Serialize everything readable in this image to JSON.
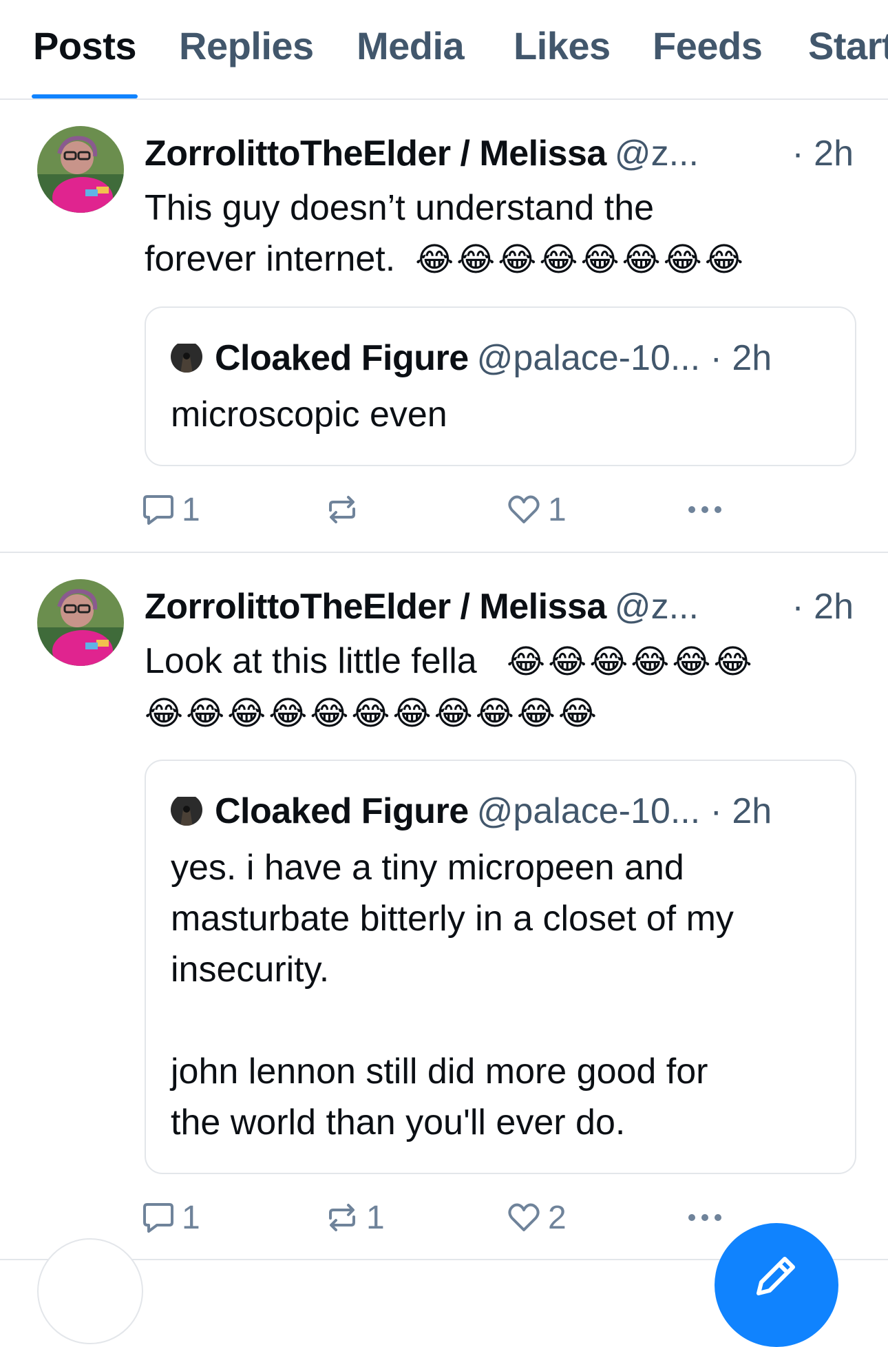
{
  "tabs": [
    {
      "label": "Posts",
      "active": true
    },
    {
      "label": "Replies",
      "active": false
    },
    {
      "label": "Media",
      "active": false
    },
    {
      "label": "Likes",
      "active": false
    },
    {
      "label": "Feeds",
      "active": false
    },
    {
      "label": "Starter Packs",
      "active": false
    }
  ],
  "colors": {
    "accent": "#1083fe",
    "text_primary": "#0b0f14",
    "text_secondary": "#42576c",
    "icon": "#6f839a",
    "divider": "#e3e6ea"
  },
  "posts": [
    {
      "author_name": "ZorrolittoTheElder / Melissa",
      "author_handle": "@z...",
      "time": "· 2h",
      "text": "This guy doesn’t understand the\nforever internet.",
      "emoji": "😂😂😂😂😂😂😂😂",
      "quote": {
        "author_name": "Cloaked Figure",
        "author_handle": "@palace-10...",
        "time": "· 2h",
        "text": "microscopic even"
      },
      "actions": {
        "reply_count": "1",
        "repost_count": "",
        "like_count": "1"
      }
    },
    {
      "author_name": "ZorrolittoTheElder / Melissa",
      "author_handle": "@z...",
      "time": "· 2h",
      "text": "Look at this little fella",
      "emoji_line1": "😂😂😂😂😂😂",
      "emoji_line2": "😂😂😂😂😂😂😂😂😂😂😂",
      "quote": {
        "author_name": "Cloaked Figure",
        "author_handle": "@palace-10...",
        "time": "· 2h",
        "text": "yes. i have a tiny micropeen and\nmasturbate bitterly in a closet of my\ninsecurity.\n\njohn lennon still did more good for\nthe world than you'll ever do."
      },
      "actions": {
        "reply_count": "1",
        "repost_count": "1",
        "like_count": "2"
      }
    }
  ],
  "icons": {
    "reply": "speech-bubble-icon",
    "repost": "repost-arrows-icon",
    "like": "heart-icon",
    "more": "ellipsis-icon",
    "compose": "pencil-icon"
  }
}
